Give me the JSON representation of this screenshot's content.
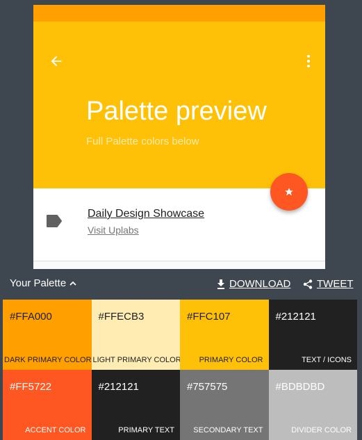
{
  "app": {
    "title": "Palette preview",
    "subtitle": "Full Palette colors below",
    "list_item": {
      "primary": "Daily Design Showcase",
      "secondary": "Visit Uplabs"
    }
  },
  "icons": {
    "back": "arrow-back-icon",
    "more": "more-vert-icon",
    "fab": "star-icon",
    "label": "label-icon",
    "download": "download-icon",
    "share": "share-icon",
    "chevron": "chevron-up-icon"
  },
  "toolbar": {
    "palette_label": "Your Palette",
    "download_label": "DOWNLOAD",
    "tweet_label": "TWEET"
  },
  "swatches": [
    {
      "hex": "#FFA000",
      "name": "DARK PRIMARY COLOR",
      "bg": "#FFA000",
      "fg": "#212121"
    },
    {
      "hex": "#FFECB3",
      "name": "LIGHT PRIMARY COLOR",
      "bg": "#FFECB3",
      "fg": "#212121"
    },
    {
      "hex": "#FFC107",
      "name": "PRIMARY COLOR",
      "bg": "#FFC107",
      "fg": "#212121"
    },
    {
      "hex": "#212121",
      "name": "TEXT / ICONS",
      "bg": "#212121",
      "fg": "#FFFFFF"
    },
    {
      "hex": "#FF5722",
      "name": "ACCENT COLOR",
      "bg": "#FF5722",
      "fg": "#FFFFFF"
    },
    {
      "hex": "#212121",
      "name": "PRIMARY TEXT",
      "bg": "#212121",
      "fg": "#FFFFFF"
    },
    {
      "hex": "#757575",
      "name": "SECONDARY TEXT",
      "bg": "#757575",
      "fg": "#FFFFFF"
    },
    {
      "hex": "#BDBDBD",
      "name": "DIVIDER COLOR",
      "bg": "#BDBDBD",
      "fg": "#FFFFFF"
    }
  ]
}
